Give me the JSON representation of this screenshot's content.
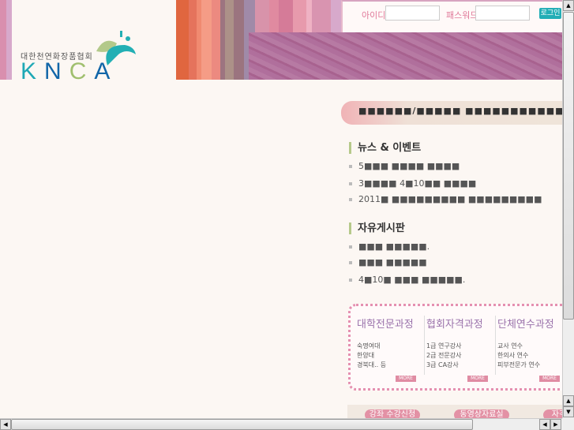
{
  "header": {
    "logo_korean": "대한천연화장품협회",
    "logo_letters": [
      "K",
      "N",
      "C",
      "A"
    ],
    "id_label": "아이디",
    "password_label": "패스워드",
    "id_value": "",
    "password_value": "",
    "login_button": "로그인"
  },
  "banner": {
    "text": "■■■■■■/■■■■■ ■■■■■■■■■■■■ ■■"
  },
  "news": {
    "title": "뉴스 & 이벤트",
    "items": [
      "5■■■ ■■■■ ■■■■",
      "3■■■■ 4■10■■ ■■■■",
      "2011■ ■■■■■■■■■ ■■■■■■■■■"
    ]
  },
  "board": {
    "title": "자유게시판",
    "items": [
      "■■■ ■■■■■.",
      "■■■ ■■■■■",
      "4■10■ ■■■ ■■■■■."
    ]
  },
  "courses": [
    {
      "title": "대학전문과정",
      "lines": [
        "숙명여대",
        "한양대",
        "경북대.. 등"
      ],
      "more": "MORE"
    },
    {
      "title": "협회자격과정",
      "lines": [
        "1급 연구강사",
        "2급 전문강사",
        "3급 CA강사"
      ],
      "more": "MORE"
    },
    {
      "title": "단체연수과정",
      "lines": [
        "교사 연수",
        "한의사 연수",
        "피부전문가 연수"
      ],
      "more": "MORE"
    }
  ],
  "bottom_nav": [
    "강좌 수강신청",
    "동영상자료실",
    "자격"
  ]
}
